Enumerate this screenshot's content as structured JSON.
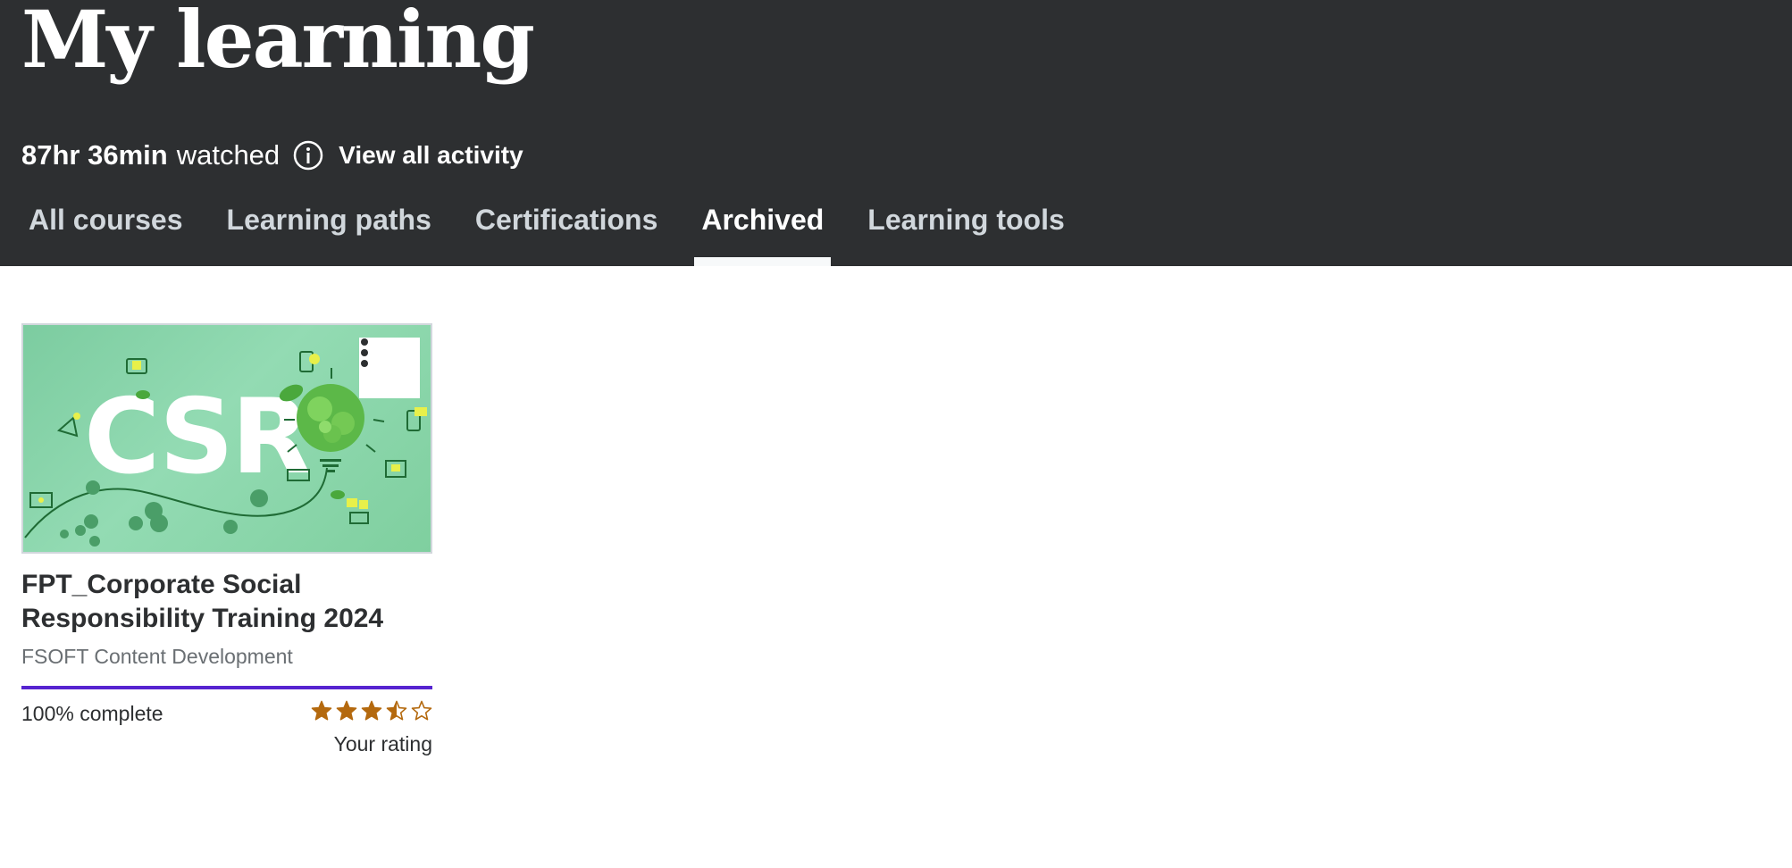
{
  "header": {
    "title": "My learning",
    "time_watched": "87hr 36min",
    "watched_label": "watched",
    "info_icon": "info-icon",
    "view_activity_label": "View all activity"
  },
  "tabs": [
    {
      "label": "All courses",
      "active": false
    },
    {
      "label": "Learning paths",
      "active": false
    },
    {
      "label": "Certifications",
      "active": false
    },
    {
      "label": "Archived",
      "active": true
    },
    {
      "label": "Learning tools",
      "active": false
    }
  ],
  "course": {
    "thumbnail_text": "CSR",
    "menu_icon": "kebab-menu-icon",
    "title": "FPT_Corporate Social Responsibility Training 2024",
    "instructor": "FSOFT Content Development",
    "progress_percent": 100,
    "progress_label": "100% complete",
    "rating": 3.5,
    "rating_max": 5,
    "rating_label": "Your rating"
  },
  "colors": {
    "header_bg": "#2d2f31",
    "progress": "#5624d0",
    "star": "#b4690e",
    "thumbnail_bg": "#8ed6ad"
  }
}
